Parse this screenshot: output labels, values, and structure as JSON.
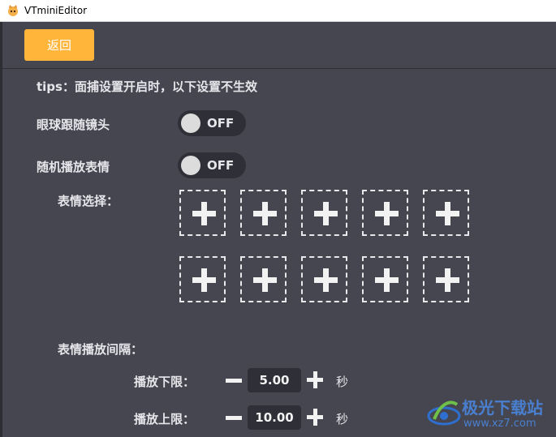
{
  "window": {
    "title": "VTminiEditor"
  },
  "header": {
    "back_label": "返回"
  },
  "tips": "tips：面捕设置开启时，以下设置不生效",
  "eye_follow": {
    "label": "眼球跟随镜头",
    "state": "OFF"
  },
  "random_expression": {
    "label": "随机播放表情",
    "state": "OFF"
  },
  "expression_select": {
    "label": "表情选择：",
    "slot_count": 10
  },
  "interval": {
    "label": "表情播放间隔：",
    "lower": {
      "label": "播放下限：",
      "value": "5.00",
      "unit": "秒"
    },
    "upper": {
      "label": "播放上限：",
      "value": "10.00",
      "unit": "秒"
    }
  },
  "watermark": {
    "text": "极光下载站",
    "url": "www.xz7.com"
  },
  "colors": {
    "accent": "#ffb53a",
    "background": "#45464f",
    "toggle_bg": "#2f3037"
  }
}
